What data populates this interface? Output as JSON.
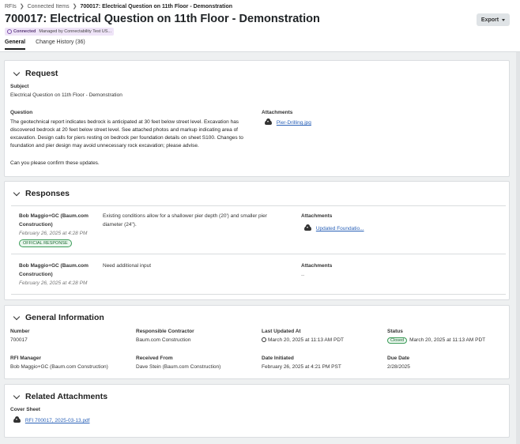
{
  "breadcrumb": {
    "items": [
      "RFIs",
      "Connected Items"
    ],
    "current": "700017: Electrical Question on 11th Floor - Demonstration"
  },
  "page": {
    "title": "700017: Electrical Question on 11th Floor - Demonstration",
    "connected_label": "Connected",
    "managed_label": "Managed by Connectability Test US...",
    "export_label": "Export"
  },
  "tabs": [
    "General",
    "Change History (36)"
  ],
  "request": {
    "title": "Request",
    "subject_label": "Subject",
    "subject": "Electrical Question on 11th Floor - Demonstration",
    "question_label": "Question",
    "question_lines": [
      "The geotechnical report indicates bedrock is anticipated at 30 feet below street level. Excavation has",
      "discovered bedrock at 20 feet below street level. See attached photos and markup indicating area of",
      "excavation. Design calls for piers resting on bedrock per foundation details on sheet S100. Changes to",
      "foundation and pier design may avoid unnecessary rock excavation; please advise."
    ],
    "question_followup": "Can you please confirm these updates.",
    "attachments_label": "Attachments",
    "attachment": "Pier-Drilling.jpg"
  },
  "responses": {
    "title": "Responses",
    "items": [
      {
        "author_line1": "Bob Maggio+GC (Baum.com",
        "author_line2": "Construction)",
        "date": "February 26, 2025 at 4:28 PM",
        "badge": "OFFICIAL RESPONSE",
        "text_line1": "Existing conditions allow for a shallower pier depth (20') and smaller pier",
        "text_line2": "diameter (24\").",
        "attachments_label": "Attachments",
        "attachment": "Updated Foundatio..."
      },
      {
        "author_line1": "Bob Maggio+GC (Baum.com",
        "author_line2": "Construction)",
        "date": "February 26, 2025 at 4:28 PM",
        "text_line1": "Need additional input",
        "attachments_label": "Attachments",
        "attachment": "--"
      }
    ]
  },
  "general": {
    "title": "General Information",
    "number_label": "Number",
    "number": "700017",
    "contractor_label": "Responsible Contractor",
    "contractor": "Baum.com Construction",
    "updated_label": "Last Updated At",
    "updated": "March 20, 2025 at 11:13 AM PDT",
    "status_label": "Status",
    "status_badge": "Closed",
    "status": "March 20, 2025 at 11:13 AM PDT",
    "manager_label": "RFI Manager",
    "manager": "Bob Maggio+GC (Baum.com Construction)",
    "received_label": "Received From",
    "received": "Dave Stein (Baum.com Construction)",
    "initiated_label": "Date Initiated",
    "initiated": "February 26, 2025 at 4:21 PM PST",
    "due_label": "Due Date",
    "due": "2/28/2025"
  },
  "related": {
    "title": "Related Attachments",
    "cover_label": "Cover Sheet",
    "cover_file": "RFI 700017, 2025-03-13.pdf"
  }
}
